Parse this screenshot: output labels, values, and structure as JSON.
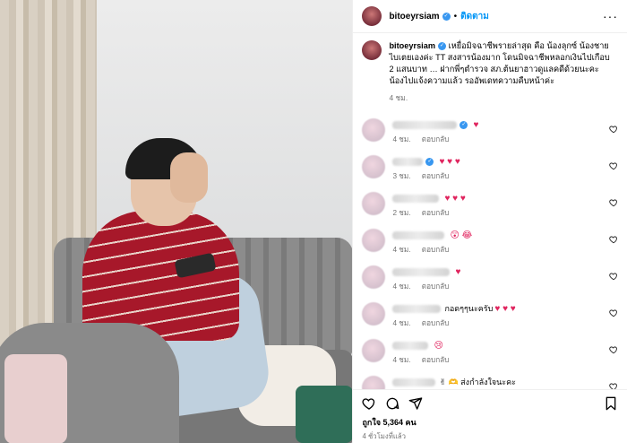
{
  "post": {
    "username": "bitoeyrsiam",
    "follow_label": "ติดตาม",
    "dot": "•",
    "more": "···",
    "caption_text": "เหยื่อมิจฉาชีพรายล่าสุด คือ น้องลุกซ์ น้องชายไบเตยเองค่ะ TT สงสารน้องมาก โดนมิจฉาชีพหลอกเงินไปเกือบ 2 แสนบาท … ฝากพี่ๆตำรวจ สภ.ต้นยาฮาวดูแลคดีด้วยนะคะ น้องไปแจ้งความแล้ว รออัพเดทความคืบหน้าค่ะ",
    "caption_time": "4 ชม.",
    "likes": "ถูกใจ 5,364 คน",
    "posted_ago": "4 ชั่วโมงที่แล้ว"
  },
  "comments": [
    {
      "text": "",
      "emoji": "♥",
      "time": "4 ชม.",
      "reply": "ตอบกลับ",
      "verified": true
    },
    {
      "text": "",
      "emoji": "♥ ♥ ♥",
      "time": "3 ชม.",
      "reply": "ตอบกลับ",
      "verified": true
    },
    {
      "text": "",
      "emoji": "♥ ♥ ♥",
      "time": "2 ชม.",
      "reply": "ตอบกลับ",
      "verified": false
    },
    {
      "text": "",
      "emoji": "😲 😂",
      "time": "4 ชม.",
      "reply": "ตอบกลับ",
      "verified": false
    },
    {
      "text": "",
      "emoji": "♥",
      "time": "4 ชม.",
      "reply": "ตอบกลับ",
      "verified": false
    },
    {
      "text": "กอดๆๆนะครับ",
      "emoji": "♥ ♥ ♥",
      "time": "4 ชม.",
      "reply": "ตอบกลับ",
      "verified": false
    },
    {
      "text": "",
      "emoji": "😢",
      "time": "4 ชม.",
      "reply": "ตอบกลับ",
      "verified": false
    },
    {
      "text": "✌ 🫶 ส่งกำลังใจนะคะ",
      "emoji": "",
      "time": "",
      "reply": "",
      "verified": false
    }
  ],
  "icons": {
    "heart": "heart-icon",
    "comment": "comment-icon",
    "share": "share-icon",
    "save": "bookmark-icon"
  },
  "colors": {
    "link": "#0095f6",
    "verified": "#3897f0",
    "heart": "#e0245e",
    "meta": "#737373"
  }
}
